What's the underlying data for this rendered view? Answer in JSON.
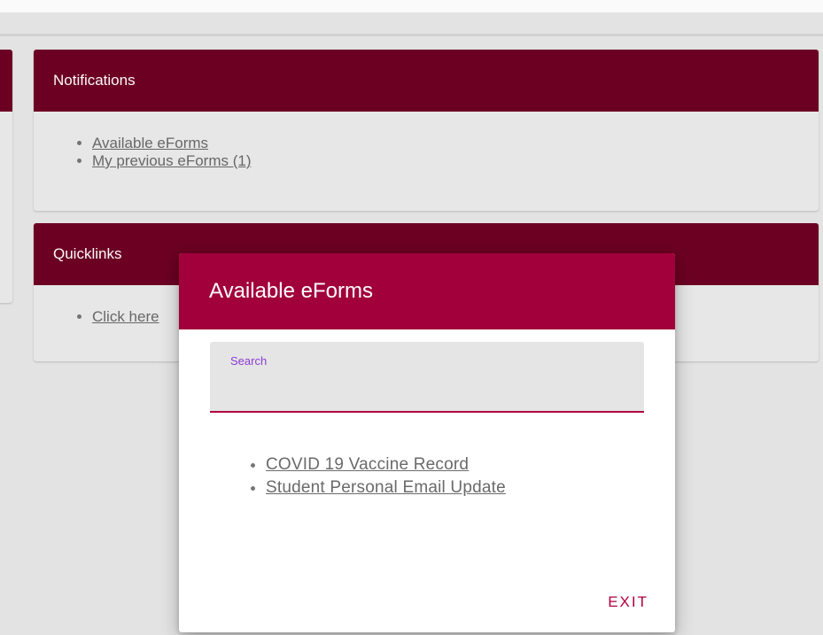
{
  "notifications": {
    "title": "Notifications",
    "items": [
      {
        "label": "Available eForms"
      },
      {
        "label": "My previous eForms (1)"
      }
    ]
  },
  "quicklinks": {
    "title": "Quicklinks",
    "items": [
      {
        "label": "Click here"
      }
    ]
  },
  "modal": {
    "title": "Available eForms",
    "search": {
      "label": "Search",
      "value": "",
      "placeholder": ""
    },
    "forms": [
      {
        "label": "COVID 19 Vaccine Record"
      },
      {
        "label": "Student Personal Email Update"
      }
    ],
    "exit_label": "EXIT"
  },
  "colors": {
    "panel_header": "#6f0024",
    "modal_header": "#a1003a",
    "accent": "#b0003e",
    "search_label": "#8a3bd6"
  }
}
